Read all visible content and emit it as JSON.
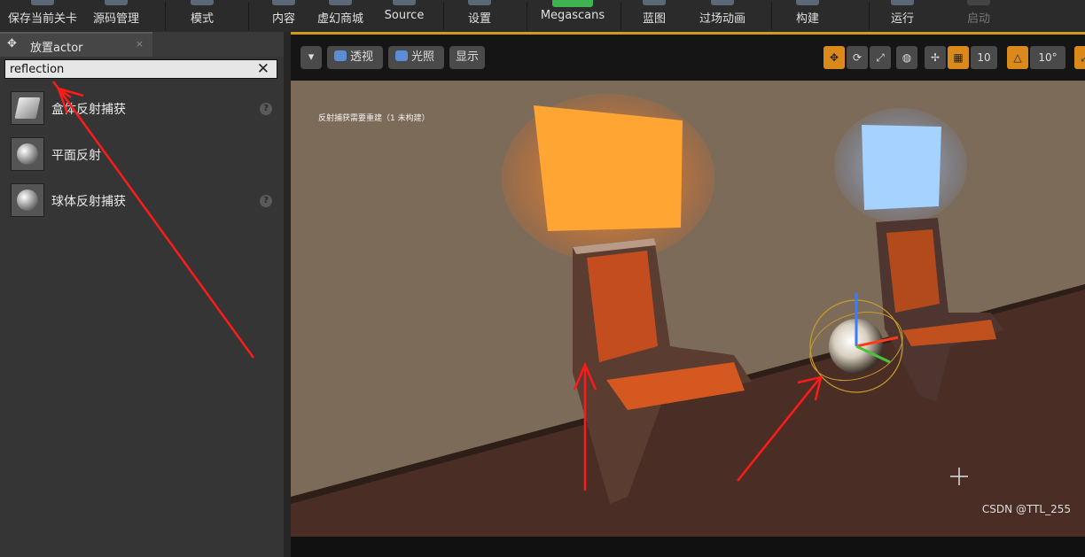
{
  "toolbar": {
    "buttons": [
      {
        "label": "保存当前关卡"
      },
      {
        "label": "源码管理"
      },
      {
        "label": "模式"
      },
      {
        "label": "内容"
      },
      {
        "label": "虚幻商城"
      },
      {
        "label": "Source"
      },
      {
        "label": "设置"
      },
      {
        "label": "Megascans"
      },
      {
        "label": "蓝图"
      },
      {
        "label": "过场动画"
      },
      {
        "label": "构建"
      },
      {
        "label": "运行"
      },
      {
        "label": "启动"
      }
    ]
  },
  "panel": {
    "tab_label": "放置actor",
    "tab_close": "×",
    "search_value": "reflection",
    "search_clear": "✕",
    "items": [
      {
        "label": "盒体反射捕获",
        "help": "?"
      },
      {
        "label": "平面反射",
        "help": ""
      },
      {
        "label": "球体反射捕获",
        "help": "?"
      }
    ]
  },
  "viewport": {
    "buttons": {
      "dropdown": "▾",
      "perspective": "透视",
      "lit": "光照",
      "show": "显示"
    },
    "right": {
      "grid_value": "10",
      "angle_value": "10°"
    },
    "scene_message": "反射捕获需要重建（1 未构建）"
  },
  "watermark": "CSDN @TTL_255",
  "colors": {
    "viewport_border": "#d09a1c",
    "annotation_arrow": "#ff1a1a"
  }
}
